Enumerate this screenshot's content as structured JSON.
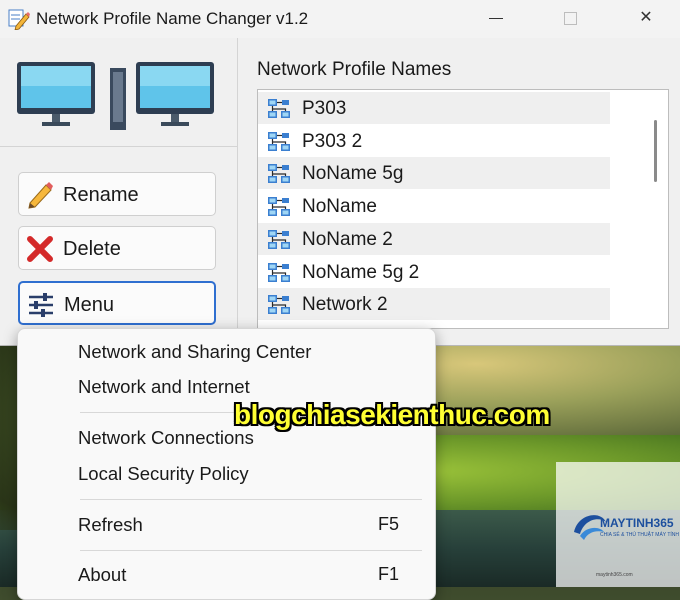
{
  "window": {
    "title": "Network Profile Name Changer v1.2",
    "close_glyph": "✕"
  },
  "buttons": {
    "rename": "Rename",
    "delete": "Delete",
    "menu": "Menu"
  },
  "profiles": {
    "heading": "Network Profile Names",
    "items": [
      "P303",
      "P303 2",
      "NoName 5g",
      "NoName",
      "NoName 2",
      "NoName 5g 2",
      "Network 2"
    ]
  },
  "context_menu": {
    "items": [
      {
        "label": "Network and Sharing Center",
        "shortcut": ""
      },
      {
        "label": "Network and Internet",
        "shortcut": ""
      },
      {
        "label": "Network Connections",
        "shortcut": ""
      },
      {
        "label": "Local Security Policy",
        "shortcut": ""
      },
      {
        "label": "Refresh",
        "shortcut": "F5"
      },
      {
        "label": "About",
        "shortcut": "F1"
      }
    ]
  },
  "watermark": {
    "text": "blogchiasekienthuc.com",
    "logo_name": "MAYTINH365",
    "logo_tagline": "CHIA SẺ & THỦ THUẬT MÁY TÍNH",
    "logo_foot": "maytinh365.com"
  },
  "colors": {
    "accent": "#2f6fd0",
    "watermark": "#ffff33",
    "delete_red": "#d42a2a"
  },
  "icons": {
    "app": "pencil-icon",
    "computers": "computers-icon",
    "rename": "pencil-icon",
    "delete": "x-icon",
    "menu": "sliders-icon",
    "network_item": "network-icon"
  }
}
